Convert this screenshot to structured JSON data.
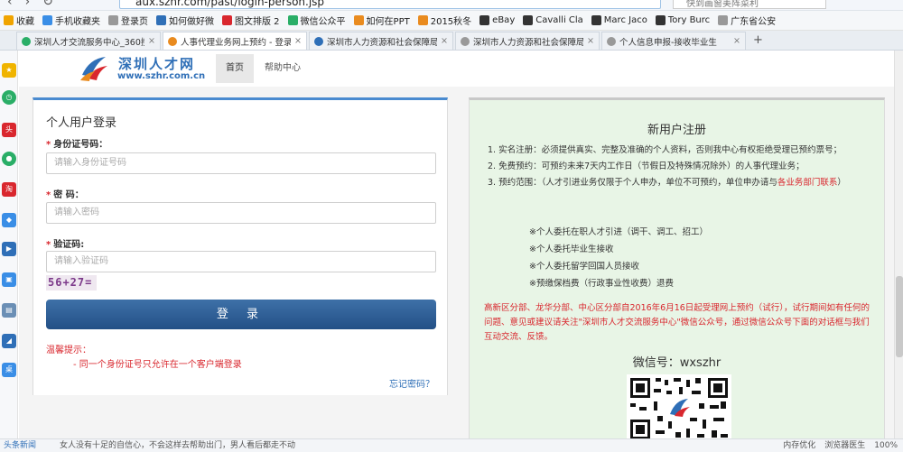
{
  "browser": {
    "url": "aux.szhr.com/past/login-person.jsp",
    "search_placeholder": "快到画窗美阵菜利",
    "bookmarks": [
      {
        "label": "收藏",
        "color": "#f0a400"
      },
      {
        "label": "手机收藏夹",
        "color": "#3a8ee6"
      },
      {
        "label": "登录页",
        "color": "#999999"
      },
      {
        "label": "如何做好微",
        "color": "#2f6fb7"
      },
      {
        "label": "图文排版 2",
        "color": "#d9272e"
      },
      {
        "label": "微信公众平",
        "color": "#2aae67"
      },
      {
        "label": "如何在PPT",
        "color": "#e98b1f"
      },
      {
        "label": "2015秋冬",
        "color": "#e98b1f"
      },
      {
        "label": "eBay",
        "color": "#333333"
      },
      {
        "label": "Cavalli Cla",
        "color": "#333333"
      },
      {
        "label": "Marc Jaco",
        "color": "#333333"
      },
      {
        "label": "Tory Burc",
        "color": "#333333"
      },
      {
        "label": "广东省公安",
        "color": "#999999"
      }
    ],
    "tabs": [
      {
        "label": "深圳人才交流服务中心_360搜",
        "color": "#2aae67",
        "active": false
      },
      {
        "label": "人事代理业务网上预约 - 登录",
        "color": "#e98b1f",
        "active": true
      },
      {
        "label": "深圳市人力资源和社会保障局",
        "color": "#2f6fb7",
        "active": false
      },
      {
        "label": "深圳市人力资源和社会保障局",
        "color": "#999999",
        "active": false
      },
      {
        "label": "个人信息申报-接收毕业生",
        "color": "#999999",
        "active": false
      }
    ],
    "new_tab": "+"
  },
  "header": {
    "logo_cn": "深圳人才网",
    "logo_en": "www.szhr.com.cn",
    "nav_home": "首页",
    "nav_help": "帮助中心"
  },
  "login": {
    "title": "个人用户登录",
    "id_label": "身份证号码：",
    "id_placeholder": "请输入身份证号码",
    "pwd_label": "密 码：",
    "pwd_placeholder": "请输入密码",
    "code_label": "验证码:",
    "code_placeholder": "请输入验证码",
    "captcha": "56+27=",
    "submit": "登 录",
    "tip_title": "温馨提示：",
    "tip_item": "- 同一个身份证号只允许在一个客户端登录",
    "forgot": "忘记密码？",
    "required_mark": "*"
  },
  "register": {
    "title": "新用户注册",
    "item1": "1. 实名注册：必须提供真实、完整及准确的个人资料，否则我中心有权拒绝受理已预约票号；",
    "item2": "2. 免费预约：可预约未来7天内工作日（节假日及特殊情况除外）的人事代理业务；",
    "item3_a": "3. 预约范围：（人才引进业务仅限于个人申办，单位不可预约，单位申办请与",
    "item3_red": "各业务部门联系",
    "item3_b": "）",
    "sub1": "※个人委托在职人才引进（调干、调工、招工）",
    "sub2": "※个人委托毕业生接收",
    "sub3": "※个人委托留学回国人员接收",
    "sub4": "※预缴保档费（行政事业性收费）退费",
    "notice": "高新区分部、龙华分部、中心区分部自2016年6月16日起受理网上预约（试行），试行期间如有任何的问题、意见或建议请关注\"深圳市人才交流服务中心\"微信公众号，通过微信公众号下面的对话框与我们互动交流、反馈。",
    "wechat": "微信号：wxszhr"
  },
  "statusbar": {
    "news_label": "头条新闻",
    "news_text": "女人没有十足的自信心，不会这样去帮助出门，男人看后都走不动",
    "right_items": [
      "内存优化",
      "浏览器医生",
      "100%"
    ]
  },
  "colors": {
    "brand_blue": "#2f6fb7",
    "button_blue": "#2c5d94",
    "alert_red": "#d9272e",
    "register_bg": "#e8f5e6"
  }
}
